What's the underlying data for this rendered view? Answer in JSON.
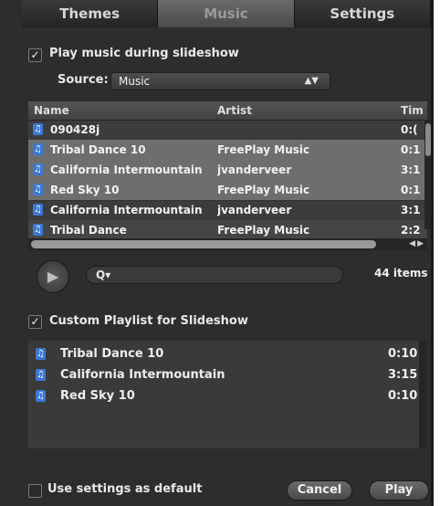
{
  "tabs": [
    "Themes",
    "Music",
    "Settings"
  ],
  "play_music": {
    "label": "Play music during slideshow",
    "checked": true
  },
  "source": {
    "label": "Source:",
    "value": "Music"
  },
  "table": {
    "headers": {
      "name": "Name",
      "artist": "Artist",
      "time": "Tim"
    },
    "rows": [
      {
        "name": "090428j",
        "artist": "",
        "time": "0:("
      },
      {
        "name": "Tribal Dance 10",
        "artist": "FreePlay Music",
        "time": "0:1"
      },
      {
        "name": "California Intermountain",
        "artist": "jvanderveer",
        "time": "3:1"
      },
      {
        "name": "Red Sky 10",
        "artist": "FreePlay Music",
        "time": "0:1"
      },
      {
        "name": "California Intermountain",
        "artist": "jvanderveer",
        "time": "3:1"
      },
      {
        "name": "Tribal Dance",
        "artist": "FreePlay Music",
        "time": "2:2"
      }
    ]
  },
  "search_icon_text": "Q▾",
  "item_count": "44 items",
  "custom_playlist": {
    "label": "Custom Playlist for Slideshow",
    "checked": true,
    "rows": [
      {
        "name": "Tribal Dance 10",
        "time": "0:10"
      },
      {
        "name": "California Intermountain",
        "time": "3:15"
      },
      {
        "name": "Red Sky 10",
        "time": "0:10"
      }
    ]
  },
  "use_default": {
    "label": "Use settings as default",
    "checked": false
  },
  "buttons": {
    "cancel": "Cancel",
    "play": "Play"
  }
}
